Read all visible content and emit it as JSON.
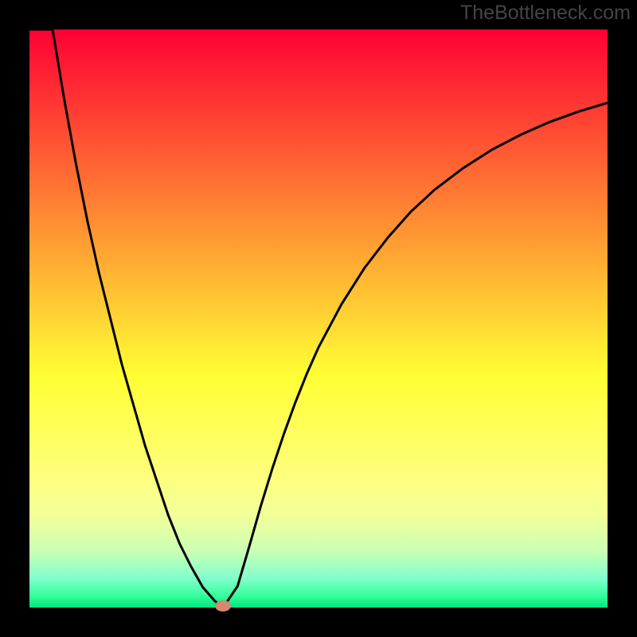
{
  "watermark": "TheBottleneck.com",
  "chart_data": {
    "type": "line",
    "title": "",
    "xlabel": "",
    "ylabel": "",
    "x": [
      0.0,
      0.02,
      0.04,
      0.06,
      0.08,
      0.1,
      0.12,
      0.14,
      0.16,
      0.18,
      0.2,
      0.22,
      0.24,
      0.26,
      0.28,
      0.3,
      0.32,
      0.335,
      0.36,
      0.38,
      0.4,
      0.42,
      0.44,
      0.46,
      0.48,
      0.5,
      0.54,
      0.58,
      0.62,
      0.66,
      0.7,
      0.75,
      0.8,
      0.85,
      0.9,
      0.95,
      1.0
    ],
    "values": [
      1.3,
      1.14,
      1.0,
      0.88,
      0.77,
      0.67,
      0.58,
      0.5,
      0.42,
      0.35,
      0.28,
      0.22,
      0.16,
      0.11,
      0.07,
      0.035,
      0.012,
      0.0,
      0.037,
      0.105,
      0.175,
      0.24,
      0.3,
      0.355,
      0.405,
      0.45,
      0.525,
      0.588,
      0.64,
      0.685,
      0.722,
      0.76,
      0.792,
      0.818,
      0.84,
      0.858,
      0.873
    ],
    "xlim": [
      0,
      1
    ],
    "ylim": [
      0,
      1
    ],
    "marker_point": {
      "x": 0.335,
      "y": 0.0
    },
    "notes": "V-shaped bottleneck curve. x is normalized horizontal position across plot area; values are normalized curve height (0 = bottom/green, 1 = top/red). Minimum at x≈0.335."
  },
  "colors": {
    "background": "#000000",
    "curve": "#000000",
    "marker": "#d4886f",
    "watermark": "#444444"
  }
}
